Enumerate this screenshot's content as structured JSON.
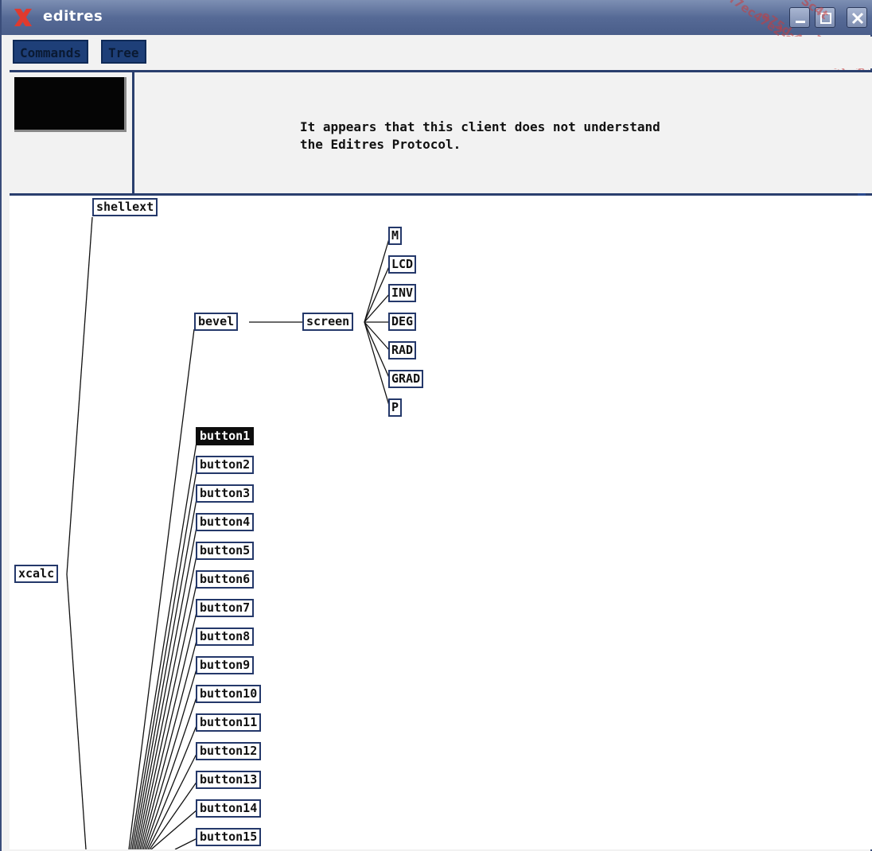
{
  "window": {
    "title": "editres"
  },
  "watermark": [
    "f7ec47e2-e75d-",
    "4846-a85",
    "Sc4t",
    "e75d-4846-a85",
    "3c47e2-e7"
  ],
  "menubar": {
    "commands_label": "Commands",
    "tree_label": "Tree"
  },
  "message": {
    "line1": "It appears that this client does not understand",
    "line2": "the Editres Protocol."
  },
  "tree": {
    "root": "xcalc",
    "shellext": "shellext",
    "bevel": "bevel",
    "screen": "screen",
    "screen_children": [
      "M",
      "LCD",
      "INV",
      "DEG",
      "RAD",
      "GRAD",
      "P"
    ],
    "buttons": [
      "button1",
      "button2",
      "button3",
      "button4",
      "button5",
      "button6",
      "button7",
      "button8",
      "button9",
      "button10",
      "button11",
      "button12",
      "button13",
      "button14",
      "button15"
    ],
    "selected": "button1"
  },
  "colors": {
    "title_bar": "#566a96",
    "node_border": "#24386a",
    "menu_button": "#1e3f78",
    "selection": "#0d0d0d"
  }
}
